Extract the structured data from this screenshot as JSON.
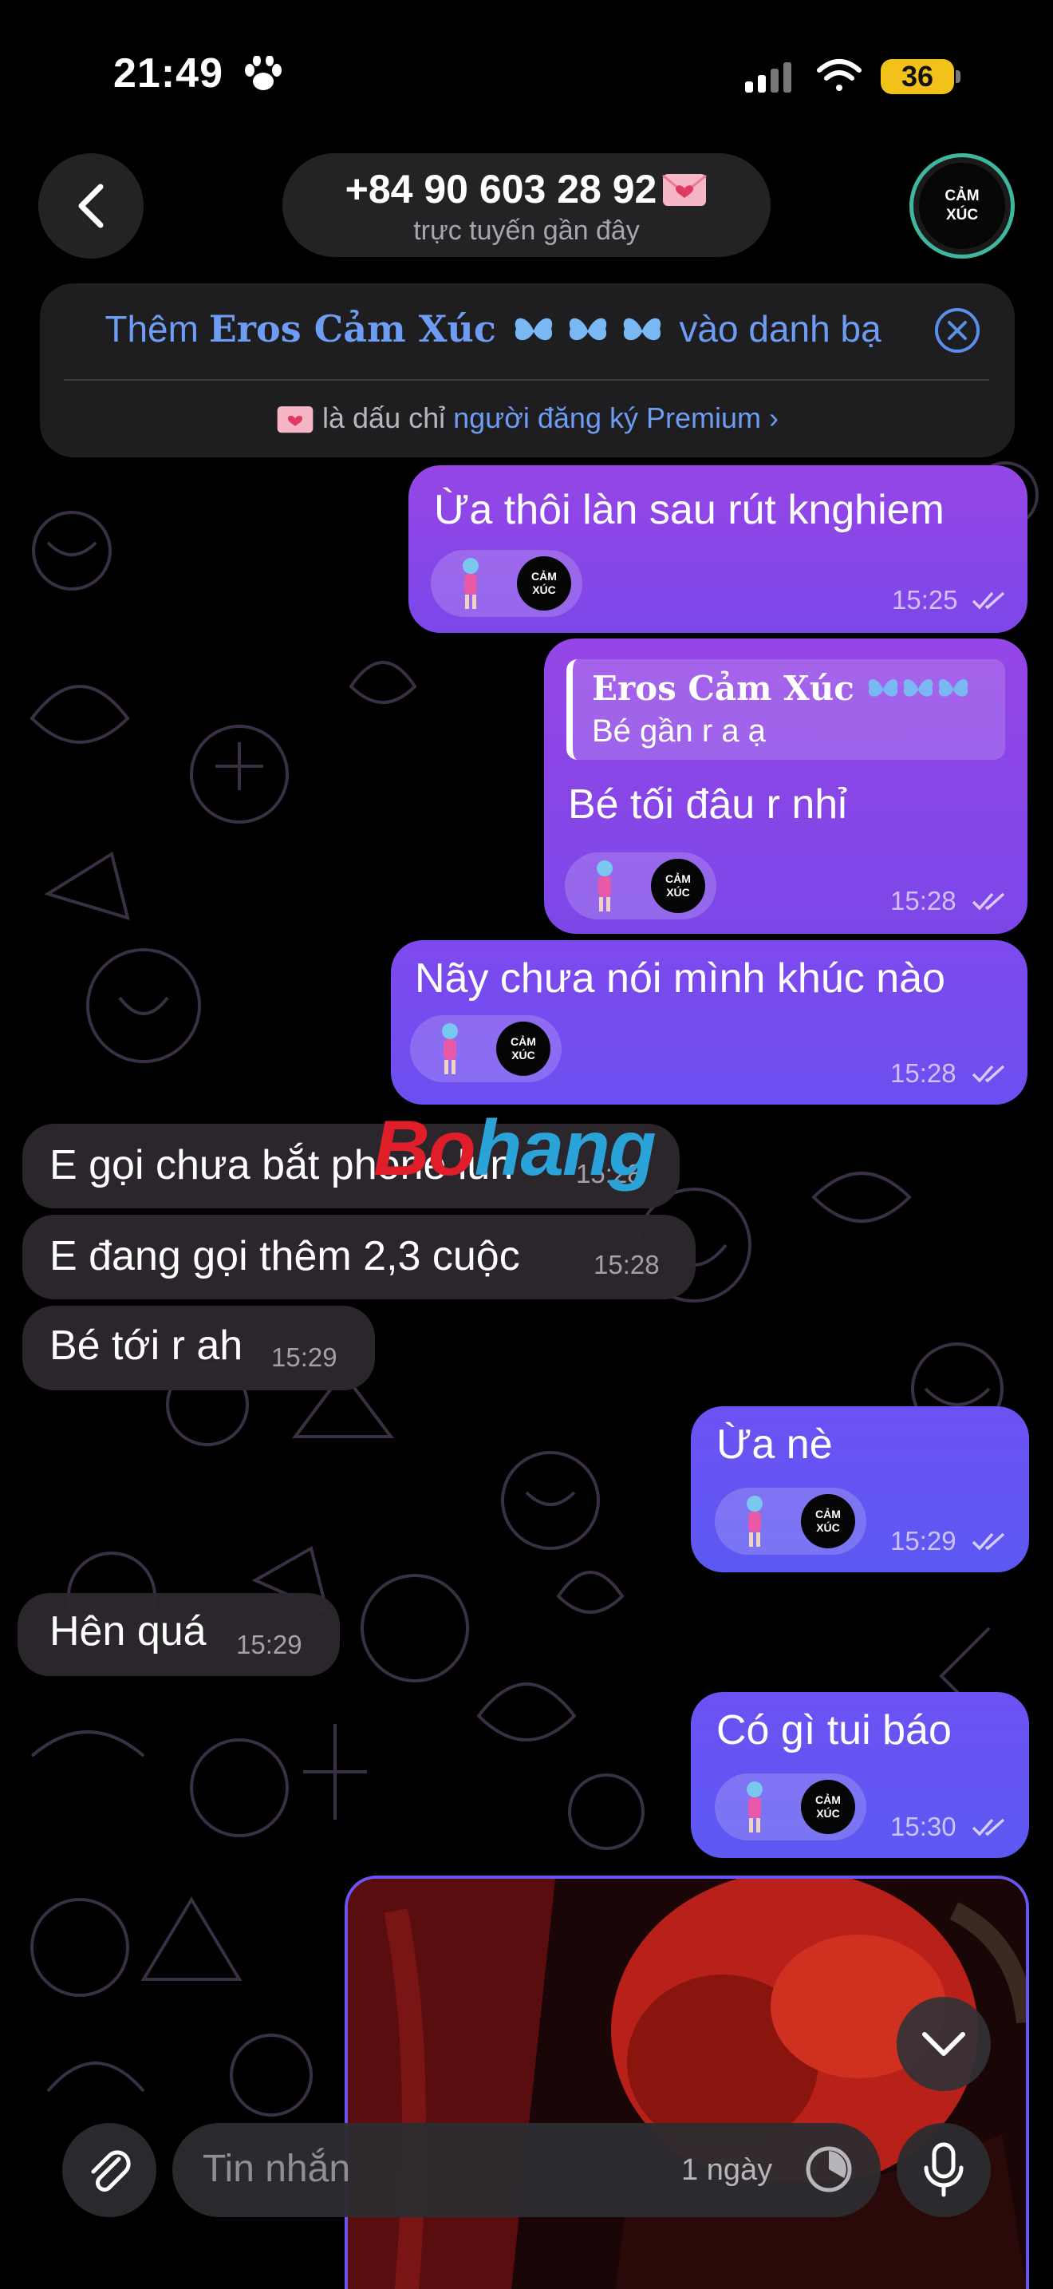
{
  "status_bar": {
    "time": "21:49",
    "battery": "36"
  },
  "header": {
    "contact_name": "+84 90 603 28 92",
    "contact_status": "trực tuyến gần đây",
    "avatar_line1": "CẢM",
    "avatar_line2": "XÚC"
  },
  "banner": {
    "add_prefix": "Thêm",
    "add_name": "Eros Cảm Xúc",
    "add_suffix": "vào danh bạ",
    "premium_text": "là dấu chỉ",
    "premium_link": "người đăng ký Premium ›"
  },
  "messages": [
    {
      "dir": "out",
      "text": "Ừa thôi làn sau rút knghiem",
      "time": "15:25"
    },
    {
      "dir": "out",
      "reply_name": "Eros Cảm Xúc",
      "reply_text": "Bé gần r a ạ",
      "text": "Bé tối đâu r nhỉ",
      "time": "15:28"
    },
    {
      "dir": "out",
      "text": "Nãy chưa nói mình khúc nào",
      "time": "15:28"
    },
    {
      "dir": "in",
      "text": "E gọi chưa bắt phone lun",
      "time": "15:28"
    },
    {
      "dir": "in",
      "text": "E đang gọi thêm 2,3 cuộc",
      "time": "15:28"
    },
    {
      "dir": "in",
      "text": "Bé tới r ah",
      "time": "15:29"
    },
    {
      "dir": "out",
      "text": "Ừa nè",
      "time": "15:29"
    },
    {
      "dir": "in",
      "text": "Hên quá",
      "time": "15:29"
    },
    {
      "dir": "out",
      "text": "Có gì tui báo",
      "time": "15:30"
    }
  ],
  "reaction_logo": {
    "line1": "CẢM",
    "line2": "XÚC"
  },
  "watermark": {
    "part1": "Bo",
    "part2": "hang"
  },
  "input_bar": {
    "placeholder": "Tin nhắn",
    "timer_label": "1 ngày"
  },
  "colors": {
    "accent": "#6d9cf2",
    "bubble_out": "#8a46e8",
    "bubble_in": "#2c282e"
  }
}
